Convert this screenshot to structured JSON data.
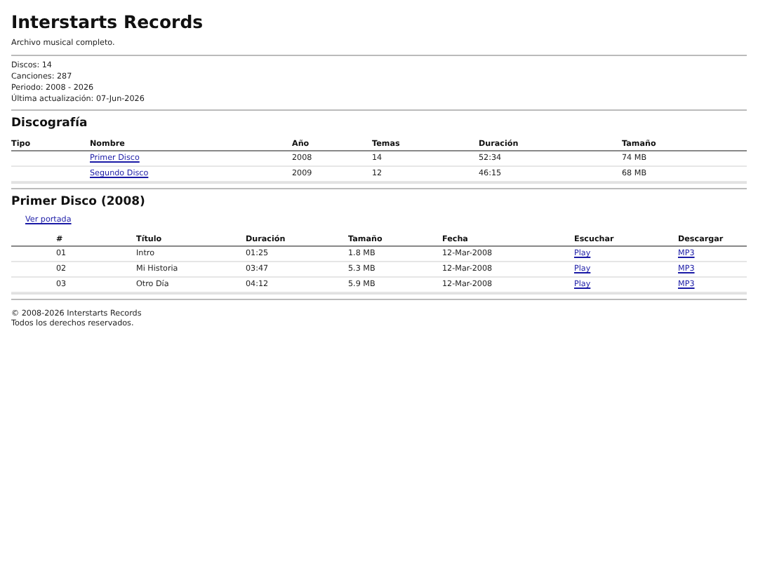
{
  "title": "Interstarts Records",
  "subtitle": "Archivo musical completo.",
  "stats": [
    "Discos: 14",
    "Canciones: 287",
    "Periodo: 2008 - 2026",
    "Última actualización: 07-Jun-2026"
  ],
  "discography": {
    "heading": "Discografía",
    "columns": [
      "Tipo",
      "Nombre",
      "Año",
      "Temas",
      "Duración",
      "Tamaño"
    ],
    "rows": [
      {
        "tipo": "",
        "nombre": "Primer Disco",
        "ano": "2008",
        "temas": "14",
        "duracion": "52:34",
        "tamano": "74 MB"
      },
      {
        "tipo": "",
        "nombre": "Segundo Disco",
        "ano": "2009",
        "temas": "12",
        "duracion": "46:15",
        "tamano": "68 MB"
      }
    ]
  },
  "album": {
    "heading": "Primer Disco (2008)",
    "cover_link": "Ver portada",
    "columns": [
      "#",
      "Título",
      "Duración",
      "Tamaño",
      "Fecha",
      "Escuchar",
      "Descargar"
    ],
    "rows": [
      {
        "num": "01",
        "titulo": "Intro",
        "duracion": "01:25",
        "tamano": "1.8 MB",
        "fecha": "12-Mar-2008",
        "escuchar": "Play",
        "descargar": "MP3"
      },
      {
        "num": "02",
        "titulo": "Mi Historia",
        "duracion": "03:47",
        "tamano": "5.3 MB",
        "fecha": "12-Mar-2008",
        "escuchar": "Play",
        "descargar": "MP3"
      },
      {
        "num": "03",
        "titulo": "Otro Día",
        "duracion": "04:12",
        "tamano": "5.9 MB",
        "fecha": "12-Mar-2008",
        "escuchar": "Play",
        "descargar": "MP3"
      }
    ]
  },
  "footer": [
    "© 2008-2026 Interstarts Records",
    "Todos los derechos reservados."
  ]
}
